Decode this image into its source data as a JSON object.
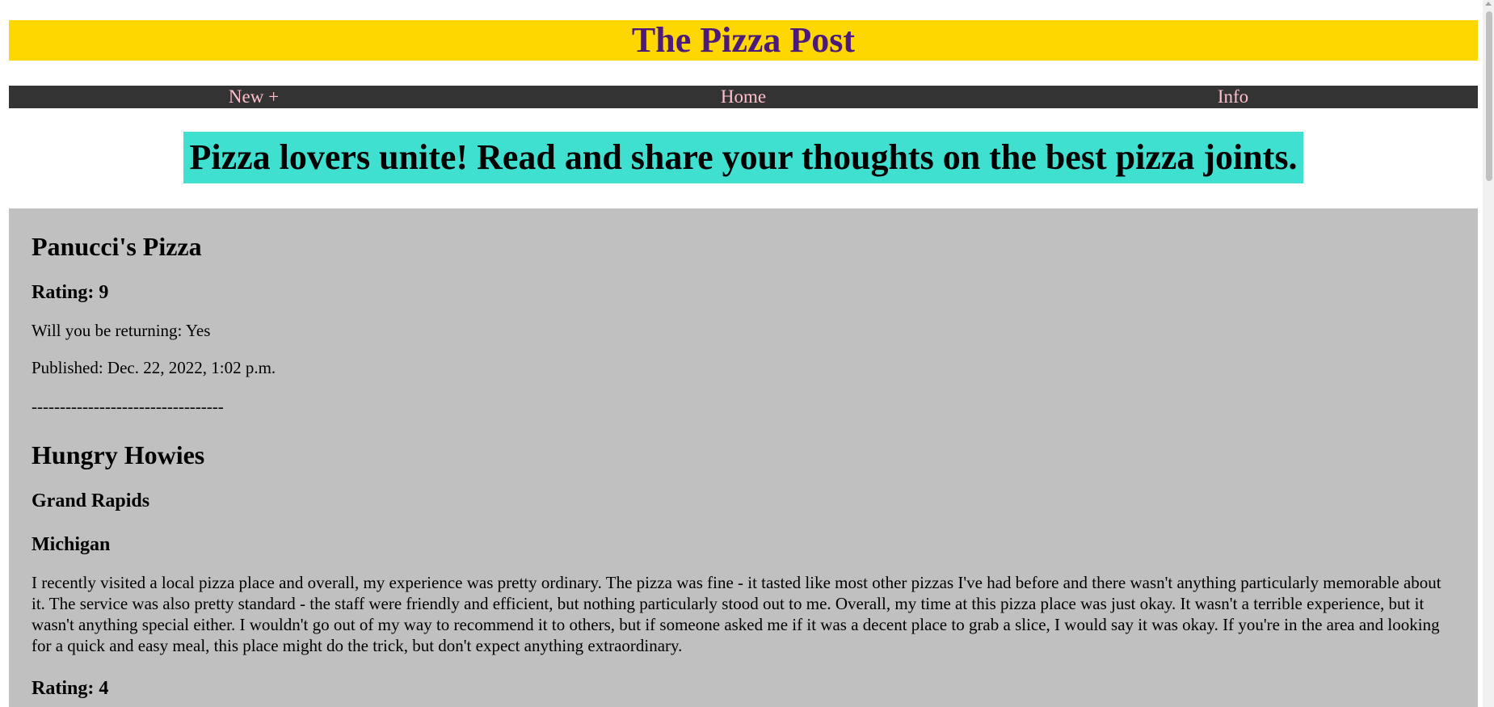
{
  "header": {
    "site_title": "The Pizza Post"
  },
  "nav": {
    "items": [
      {
        "label": "New +"
      },
      {
        "label": "Home"
      },
      {
        "label": "Info"
      }
    ]
  },
  "banner": {
    "text": "Pizza lovers unite! Read and share your thoughts on the best pizza joints."
  },
  "posts": [
    {
      "name": "Panucci's Pizza",
      "rating": "Rating: 9",
      "returning": "Will you be returning: Yes",
      "published": "Published: Dec. 22, 2022, 1:02 p.m.",
      "divider": "----------------------------------"
    },
    {
      "name": "Hungry Howies",
      "city": "Grand Rapids",
      "state": "Michigan",
      "review": "I recently visited a local pizza place and overall, my experience was pretty ordinary. The pizza was fine - it tasted like most other pizzas I've had before and there wasn't anything particularly memorable about it. The service was also pretty standard - the staff were friendly and efficient, but nothing particularly stood out to me. Overall, my time at this pizza place was just okay. It wasn't a terrible experience, but it wasn't anything special either. I wouldn't go out of my way to recommend it to others, but if someone asked me if it was a decent place to grab a slice, I would say it was okay. If you're in the area and looking for a quick and easy meal, this place might do the trick, but don't expect anything extraordinary.",
      "rating": "Rating: 4"
    }
  ]
}
